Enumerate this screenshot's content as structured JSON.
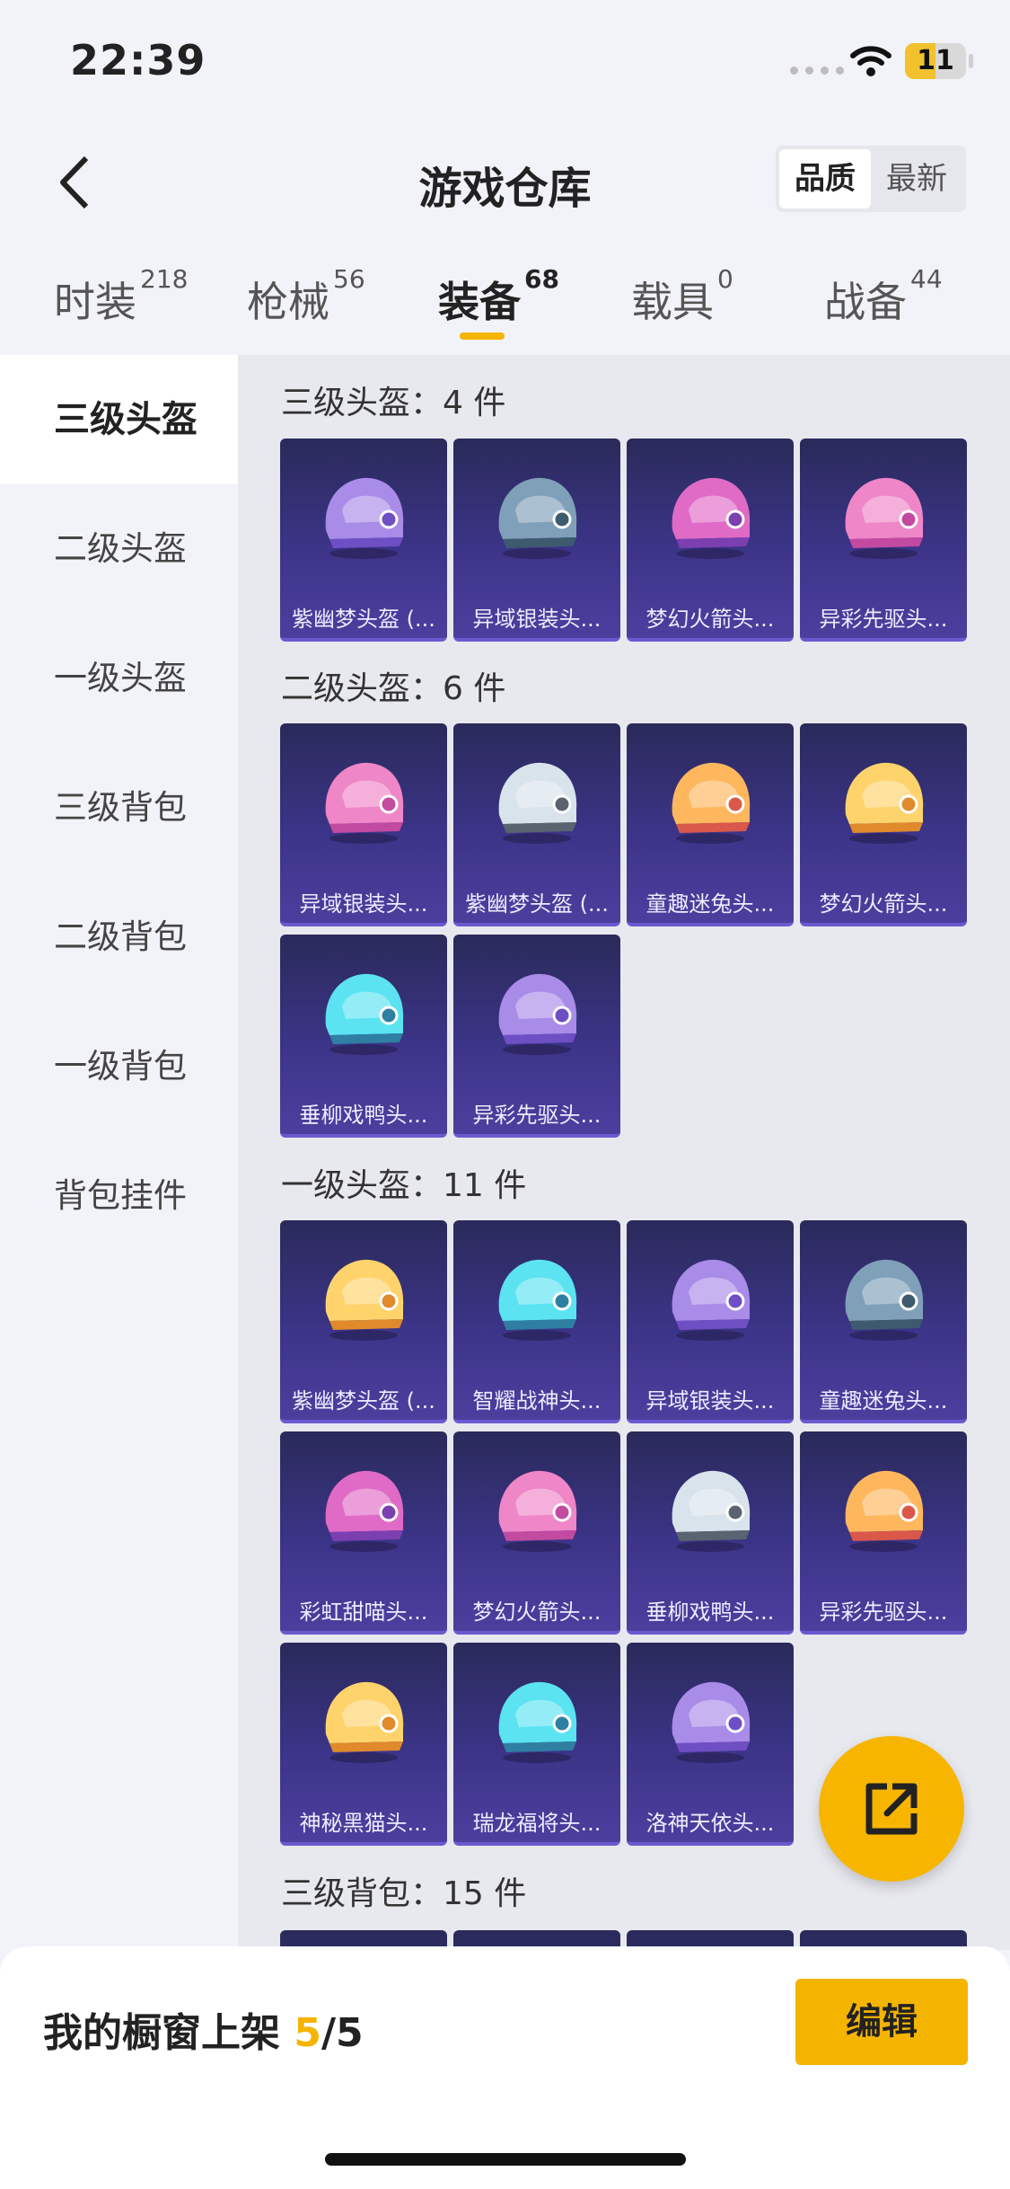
{
  "status_bar": {
    "time": "22:39",
    "battery": "11",
    "battery_level": 0.5
  },
  "header": {
    "back_icon": "chevron-left-icon",
    "title": "游戏仓库",
    "sort_options": [
      "品质",
      "最新"
    ],
    "sort_active": "品质"
  },
  "tabs": [
    {
      "label": "时装",
      "count": "218"
    },
    {
      "label": "枪械",
      "count": "56"
    },
    {
      "label": "装备",
      "count": "68",
      "active": true
    },
    {
      "label": "载具",
      "count": "0"
    },
    {
      "label": "战备",
      "count": "44"
    }
  ],
  "sidebar": [
    "三级头盔",
    "二级头盔",
    "一级头盔",
    "三级背包",
    "二级背包",
    "一级背包",
    "背包挂件"
  ],
  "sections": [
    {
      "title": "三级头盔：4 件",
      "items": [
        "紫幽梦头盔 (...",
        "异域银装头...",
        "梦幻火箭头...",
        "异彩先驱头..."
      ]
    },
    {
      "title": "二级头盔：6 件",
      "items": [
        "异域银装头...",
        "紫幽梦头盔 (...",
        "童趣迷兔头...",
        "梦幻火箭头...",
        "垂柳戏鸭头...",
        "异彩先驱头..."
      ]
    },
    {
      "title": "一级头盔：11 件",
      "items": [
        "紫幽梦头盔 (...",
        "智耀战神头...",
        "异域银装头...",
        "童趣迷兔头...",
        "彩虹甜喵头...",
        "梦幻火箭头...",
        "垂柳戏鸭头...",
        "异彩先驱头...",
        "神秘黑猫头...",
        "瑞龙福将头...",
        "洛神天依头..."
      ]
    },
    {
      "title": "三级背包：15 件",
      "items": []
    }
  ],
  "fab": {
    "icon": "share-external-icon"
  },
  "bottom": {
    "prefix": "我的橱窗上架 ",
    "count": "5",
    "suffix": "/5",
    "edit_label": "编辑"
  },
  "colors": {
    "accent": "#f5b400",
    "card_top": "#2a2a5a",
    "card_bottom": "#4b3f9e"
  }
}
